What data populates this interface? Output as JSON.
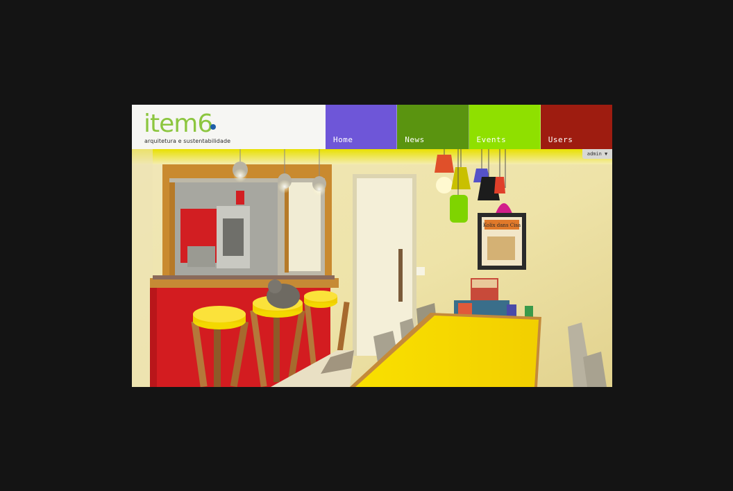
{
  "logo": {
    "word": "item",
    "digit": "6",
    "tagline": "arquitetura e sustentabilidade"
  },
  "nav": [
    {
      "label": "Home",
      "color": "#6e56d8"
    },
    {
      "label": "News",
      "color": "#5a9410"
    },
    {
      "label": "Events",
      "color": "#8fe000"
    },
    {
      "label": "Users",
      "color": "#9e1c10"
    }
  ],
  "admin": {
    "label": "admin ▼"
  },
  "photo": {
    "book_title": "Kolix dans Cisa"
  },
  "colors": {
    "page_bg": "#141414",
    "logo_green": "#8cc63f",
    "table_yellow": "#f7d800",
    "counter_red": "#d31c20"
  }
}
